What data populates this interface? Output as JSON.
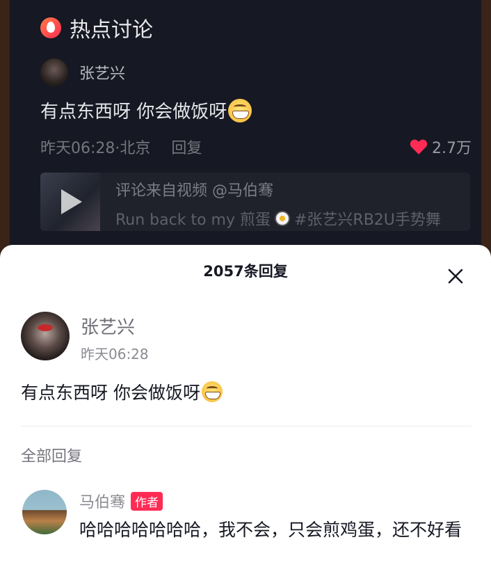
{
  "background": {
    "section_title": "热点讨论",
    "comment": {
      "username": "张艺兴",
      "text": "有点东西呀 你会做饭呀",
      "time_location": "昨天06:28·北京",
      "reply_label": "回复",
      "likes": "2.7万"
    },
    "video": {
      "source": "评论来自视频 @马伯骞",
      "caption_before": "Run back to my 煎蛋",
      "caption_after": " #张艺兴RB2U手势舞"
    }
  },
  "sheet": {
    "title": "2057条回复",
    "main_comment": {
      "username": "张艺兴",
      "time": "昨天06:28",
      "text": "有点东西呀 你会做饭呀"
    },
    "all_replies_label": "全部回复",
    "replies": [
      {
        "username": "马伯骞",
        "badge": "作者",
        "text": "哈哈哈哈哈哈哈，我不会，只会煎鸡蛋，还不好看"
      }
    ]
  },
  "colors": {
    "accent": "#fe2c55",
    "dark_bg": "#161823"
  }
}
